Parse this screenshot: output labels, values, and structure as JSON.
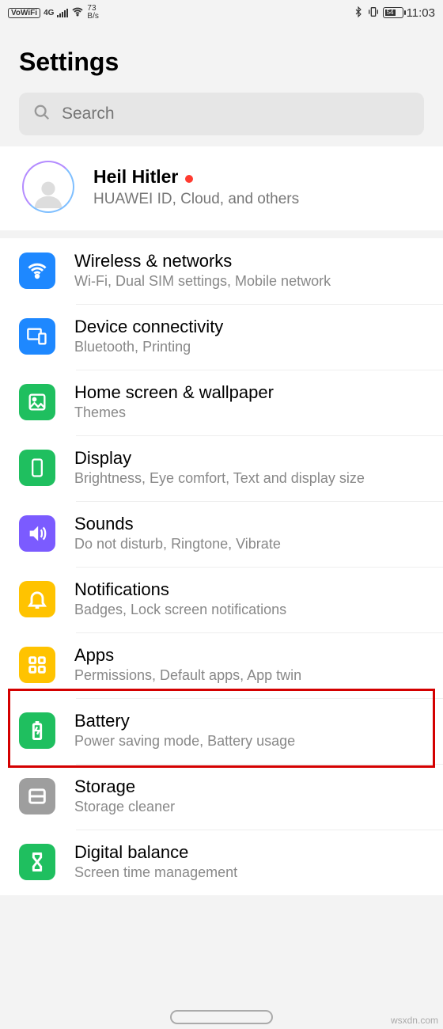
{
  "status": {
    "vowifi": "VoWiFi",
    "net": "4G",
    "speed_top": "73",
    "speed_unit": "B/s",
    "battery": "54",
    "time": "11:03"
  },
  "header": {
    "title": "Settings"
  },
  "search": {
    "placeholder": "Search"
  },
  "profile": {
    "name": "Heil Hitler",
    "sub": "HUAWEI ID, Cloud, and others"
  },
  "rows": [
    {
      "icon": "wifi-icon",
      "color": "bg-blue",
      "title": "Wireless & networks",
      "sub": "Wi-Fi, Dual SIM settings, Mobile network"
    },
    {
      "icon": "devices-icon",
      "color": "bg-blue",
      "title": "Device connectivity",
      "sub": "Bluetooth, Printing"
    },
    {
      "icon": "wallpaper-icon",
      "color": "bg-green",
      "title": "Home screen & wallpaper",
      "sub": "Themes"
    },
    {
      "icon": "display-icon",
      "color": "bg-green",
      "title": "Display",
      "sub": "Brightness, Eye comfort, Text and display size"
    },
    {
      "icon": "sound-icon",
      "color": "bg-purple",
      "title": "Sounds",
      "sub": "Do not disturb, Ringtone, Vibrate"
    },
    {
      "icon": "bell-icon",
      "color": "bg-yellow",
      "title": "Notifications",
      "sub": "Badges, Lock screen notifications"
    },
    {
      "icon": "apps-icon",
      "color": "bg-yellow",
      "title": "Apps",
      "sub": "Permissions, Default apps, App twin"
    },
    {
      "icon": "battery-icon",
      "color": "bg-green",
      "title": "Battery",
      "sub": "Power saving mode, Battery usage"
    },
    {
      "icon": "storage-icon",
      "color": "bg-grey",
      "title": "Storage",
      "sub": "Storage cleaner"
    },
    {
      "icon": "hourglass-icon",
      "color": "bg-green",
      "title": "Digital balance",
      "sub": "Screen time management"
    }
  ],
  "highlight_index": 6,
  "watermark": "wsxdn.com"
}
